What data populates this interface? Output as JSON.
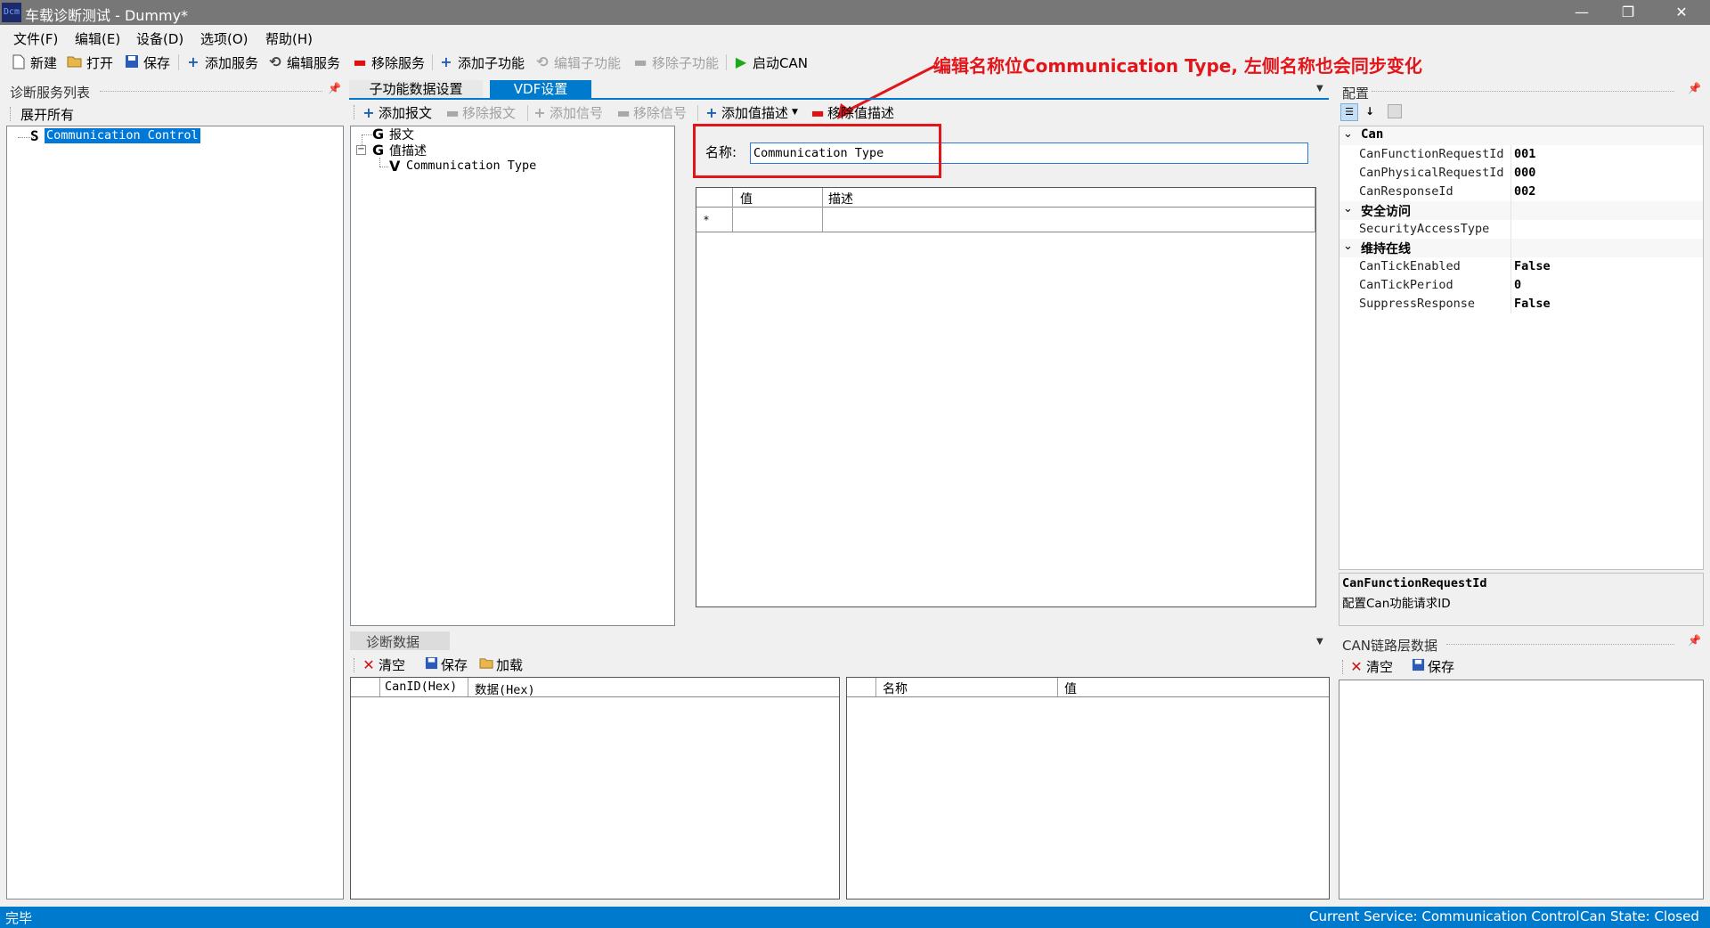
{
  "window": {
    "icon_text": "Dcm",
    "title": "车载诊断测试 - Dummy*",
    "minimize_icon": "—",
    "restore_icon": "❐",
    "close_icon": "✕"
  },
  "menu": [
    "文件(F)",
    "编辑(E)",
    "设备(D)",
    "选项(O)",
    "帮助(H)"
  ],
  "toolbar": {
    "new": "新建",
    "open": "打开",
    "save": "保存",
    "add_service": "添加服务",
    "edit_service": "编辑服务",
    "remove_service": "移除服务",
    "add_subfunc": "添加子功能",
    "edit_subfunc": "编辑子功能",
    "remove_subfunc": "移除子功能",
    "start_can": "启动CAN"
  },
  "left_panel": {
    "title": "诊断服务列表",
    "expand_all": "展开所有",
    "tree_item_prefix": "S",
    "tree_item": "Communication Control"
  },
  "center": {
    "tabs": [
      "子功能数据设置",
      "VDF设置"
    ],
    "sub_toolbar": {
      "add_message": "添加报文",
      "remove_message": "移除报文",
      "add_signal": "添加信号",
      "remove_signal": "移除信号",
      "add_value_desc": "添加值描述",
      "remove_value_desc": "移除值描述"
    },
    "tree": {
      "node1_prefix": "G",
      "node1": "报文",
      "node2_prefix": "G",
      "node2": "值描述",
      "child_prefix": "V",
      "child": "Communication Type",
      "collapse_glyph": "−"
    },
    "name_label": "名称:",
    "name_value": "Communication Type",
    "grid": {
      "col_value": "值",
      "col_desc": "描述",
      "new_row_marker": "*"
    }
  },
  "right_panel": {
    "title": "配置",
    "categories": [
      {
        "name": "Can",
        "props": [
          {
            "name": "CanFunctionRequestId",
            "value": "001"
          },
          {
            "name": "CanPhysicalRequestId",
            "value": "000"
          },
          {
            "name": "CanResponseId",
            "value": "002"
          }
        ]
      },
      {
        "name": "安全访问",
        "props": [
          {
            "name": "SecurityAccessType",
            "value": ""
          }
        ]
      },
      {
        "name": "维持在线",
        "props": [
          {
            "name": "CanTickEnabled",
            "value": "False"
          },
          {
            "name": "CanTickPeriod",
            "value": "0"
          },
          {
            "name": "SuppressResponse",
            "value": "False"
          }
        ]
      }
    ],
    "help_title": "CanFunctionRequestId",
    "help_desc": "配置Can功能请求ID"
  },
  "diag_panel": {
    "title": "诊断数据",
    "clear": "清空",
    "save": "保存",
    "load": "加载",
    "left_cols": [
      "CanID(Hex)",
      "数据(Hex)"
    ],
    "right_cols": [
      "名称",
      "值"
    ]
  },
  "can_panel": {
    "title": "CAN链路层数据",
    "clear": "清空",
    "save": "保存"
  },
  "status": {
    "left": "完毕",
    "current_service": "Current Service: Communication Control",
    "can_state": "Can State: Closed"
  },
  "annotation": {
    "text": "编辑名称位Communication Type, 左侧名称也会同步变化",
    "color": "#e0161b"
  },
  "colors": {
    "accent": "#007acc",
    "titlebar": "#777777",
    "selection": "#0078d7"
  }
}
